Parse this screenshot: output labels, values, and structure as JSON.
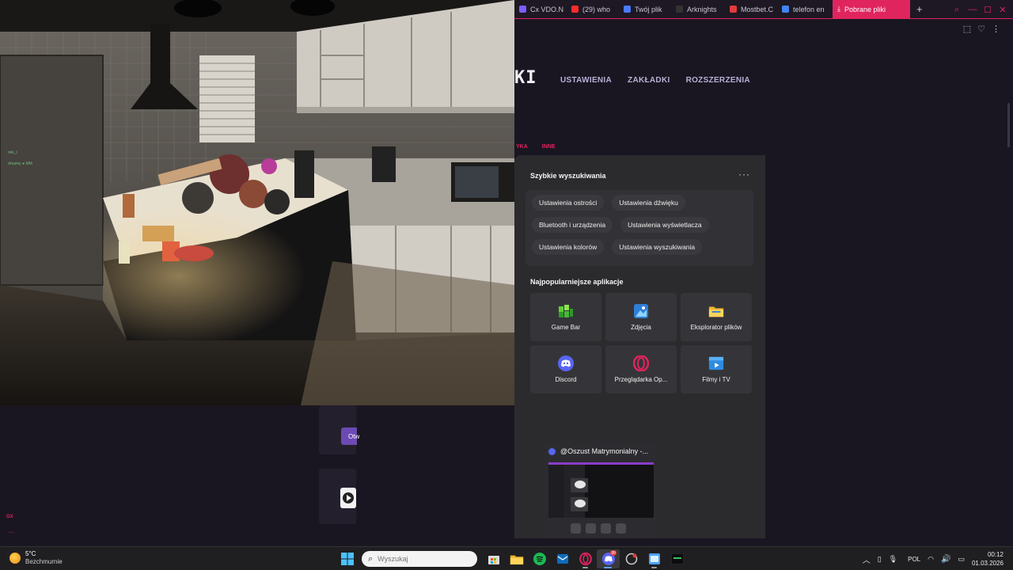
{
  "browser": {
    "tabs": [
      {
        "label": "Cx VDO.N",
        "color": "#7b5cff"
      },
      {
        "label": "(29) who",
        "color": "#ff2a2a"
      },
      {
        "label": "Twój plik",
        "color": "#4a7bff"
      },
      {
        "label": "Arknights",
        "color": "#333333"
      },
      {
        "label": "Mostbet.C",
        "color": "#e23b3b"
      },
      {
        "label": "telefon en",
        "color": "#4285f4"
      }
    ],
    "active_tab": "Pobrane pliki",
    "new_tab_symbol": "+",
    "page_title": "KI",
    "nav": [
      "USTAWIENIA",
      "ZAKŁADKI",
      "ROZSZERZENIA"
    ],
    "sub_links": [
      "YKA",
      "INNE"
    ],
    "accent": "#e0245e",
    "bg_button_label": "Otw",
    "corner_label": "GX",
    "corner_dots": "···"
  },
  "game": {
    "overlay_lines": [
      "mik_l",
      "dreamy ● MM"
    ]
  },
  "search_flyout": {
    "quick_title": "Szybkie wyszukiwania",
    "more": "···",
    "quick_rows": [
      [
        "Ustawienia ostrości",
        "Ustawienia dźwięku"
      ],
      [
        "Bluetooth i urządzenia",
        "Ustawienia wyświetlacza"
      ],
      [
        "Ustawienia kolorów",
        "Ustawienia wyszukiwania"
      ]
    ],
    "apps_title": "Najpopularniejsze aplikacje",
    "apps": [
      {
        "label": "Game Bar",
        "icon": "game-bar-icon"
      },
      {
        "label": "Zdjęcia",
        "icon": "photos-icon"
      },
      {
        "label": "Eksplorator plików",
        "icon": "folder-icon"
      },
      {
        "label": "Discord",
        "icon": "discord-icon"
      },
      {
        "label": "Przeglądarka Op...",
        "icon": "opera-icon"
      },
      {
        "label": "Filmy i TV",
        "icon": "films-tv-icon"
      }
    ]
  },
  "discord_preview": {
    "title": "@Oszust Matrymonialny -..."
  },
  "taskbar": {
    "weather_temp": "5°C",
    "weather_desc": "Bezchmurnie",
    "search_placeholder": "Wyszukaj",
    "discord_badge": "99",
    "language": "POL",
    "time": "00:12",
    "date": "01.03.2026"
  }
}
